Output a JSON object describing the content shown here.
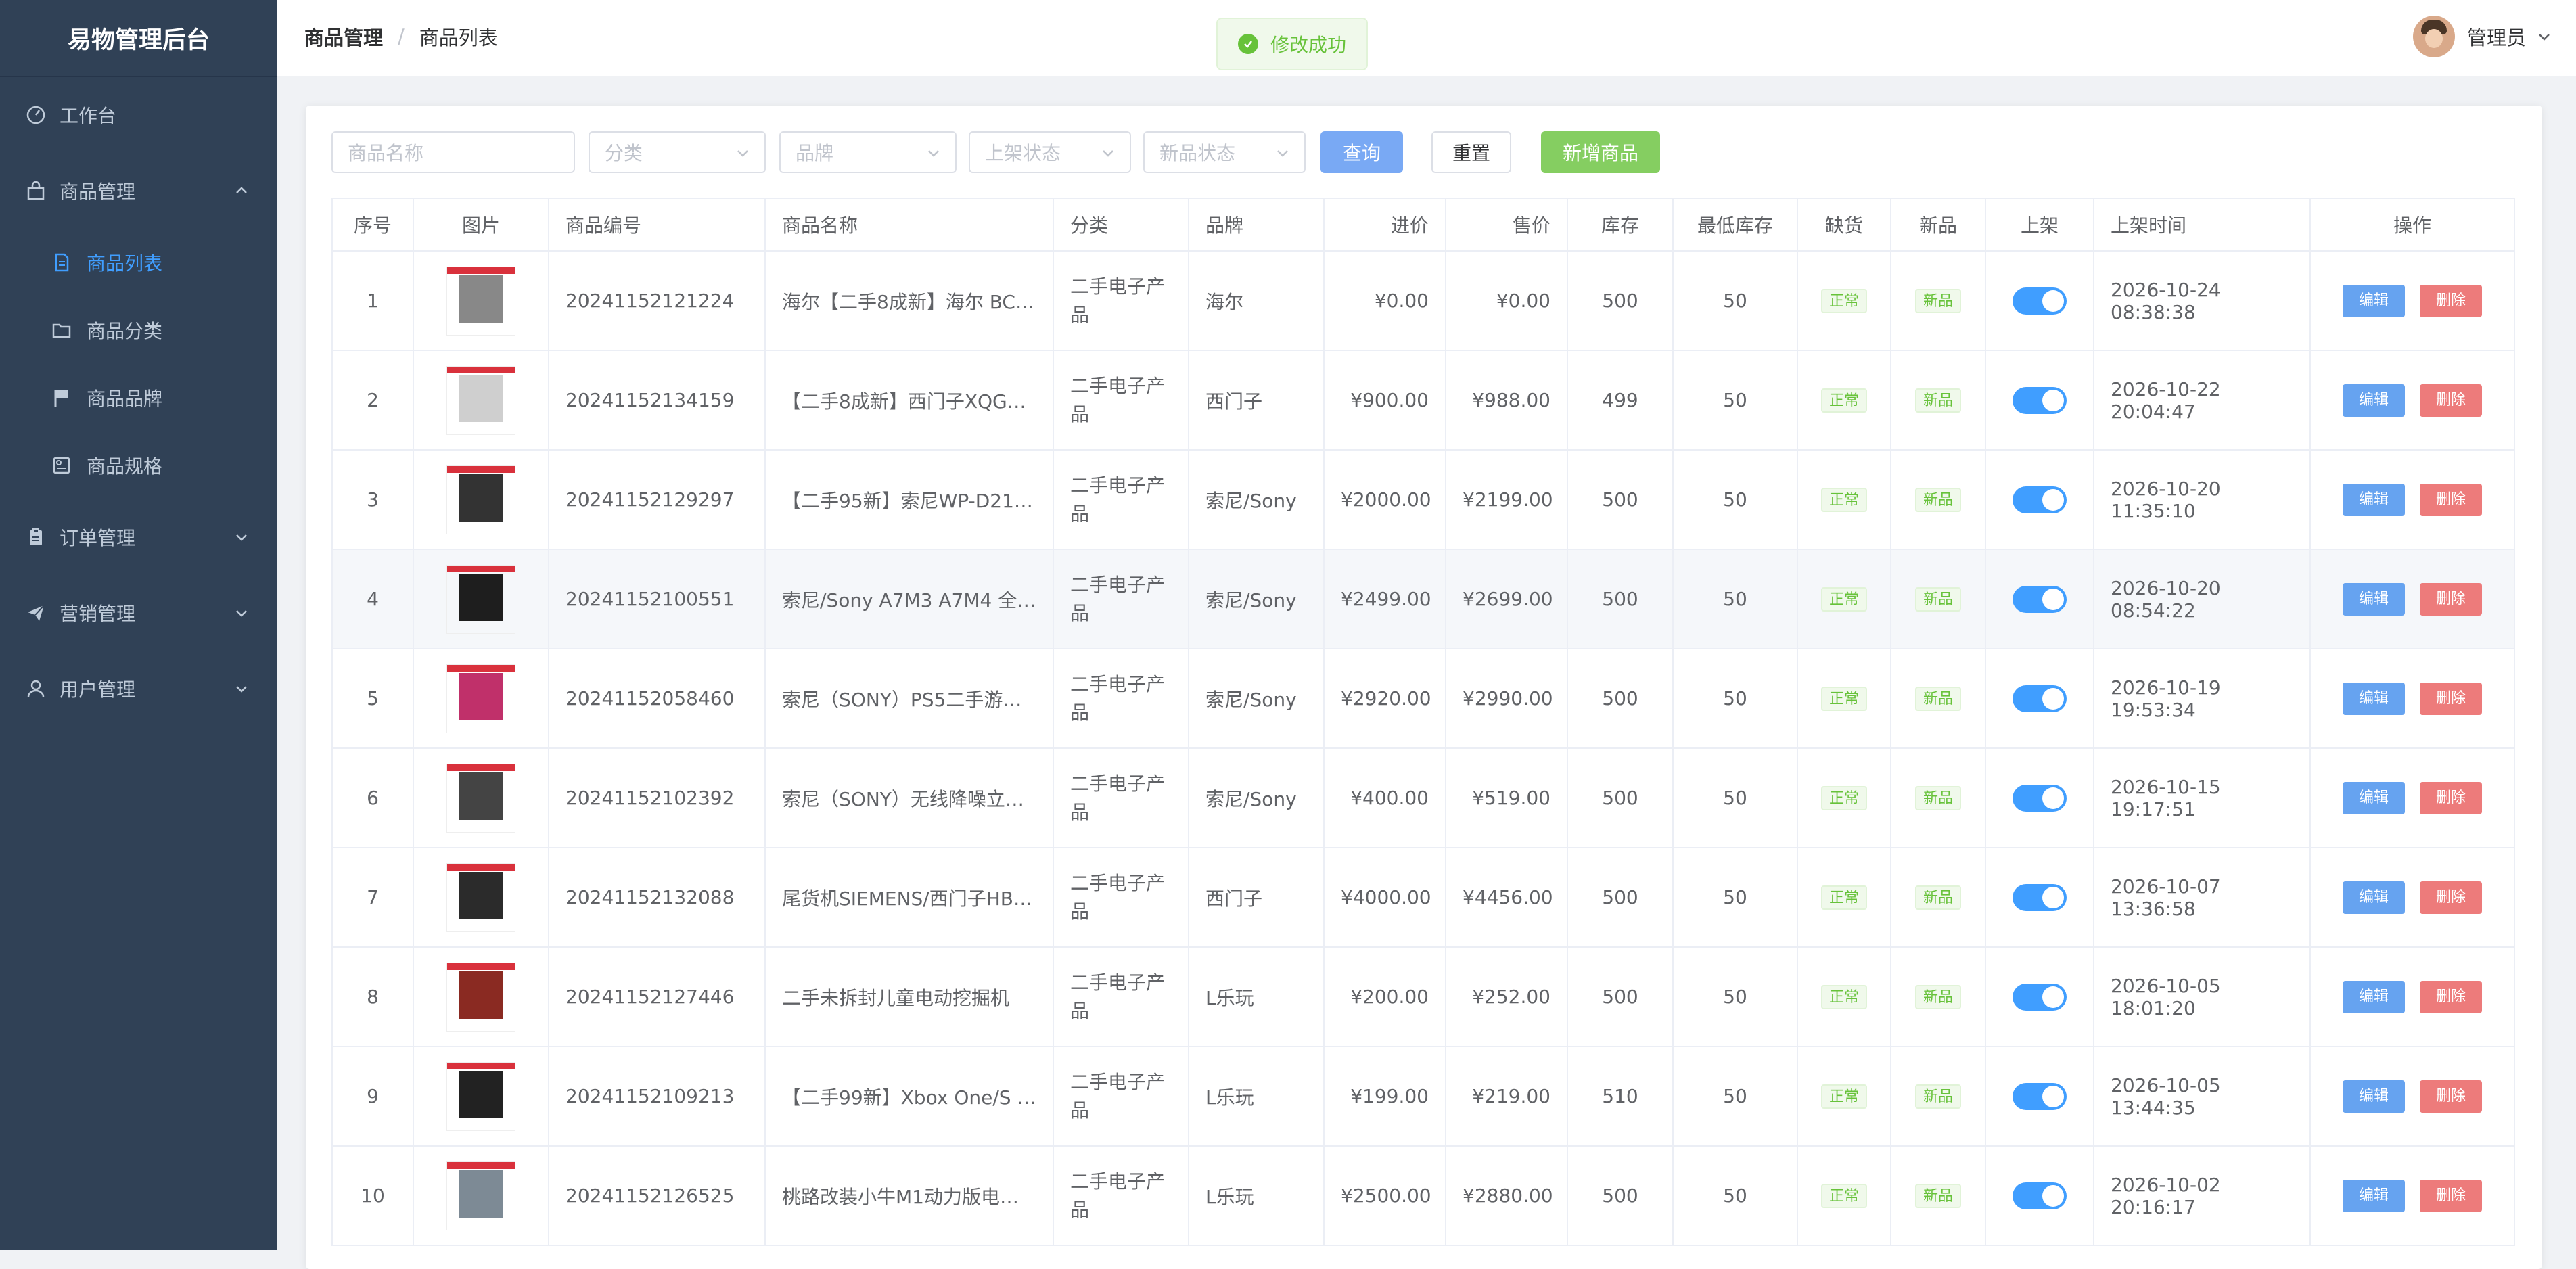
{
  "app": {
    "title": "易物管理后台"
  },
  "sidebar": {
    "items": [
      {
        "label": "工作台",
        "icon": "dashboard-icon"
      },
      {
        "label": "商品管理",
        "icon": "shopping-bag-icon",
        "expanded": true,
        "children": [
          {
            "label": "商品列表",
            "icon": "document-icon",
            "active": true
          },
          {
            "label": "商品分类",
            "icon": "folder-icon"
          },
          {
            "label": "商品品牌",
            "icon": "flag-icon"
          },
          {
            "label": "商品规格",
            "icon": "spec-icon"
          }
        ]
      },
      {
        "label": "订单管理",
        "icon": "order-icon"
      },
      {
        "label": "营销管理",
        "icon": "send-icon"
      },
      {
        "label": "用户管理",
        "icon": "user-icon"
      }
    ]
  },
  "header": {
    "breadcrumb": [
      "商品管理",
      "商品列表"
    ],
    "separator": "/",
    "user_name": "管理员"
  },
  "toast": {
    "message": "修改成功",
    "type": "success"
  },
  "filters": {
    "name_placeholder": "商品名称",
    "category_placeholder": "分类",
    "brand_placeholder": "品牌",
    "shelf_placeholder": "上架状态",
    "new_placeholder": "新品状态",
    "query_label": "查询",
    "reset_label": "重置",
    "add_label": "新增商品"
  },
  "table": {
    "headers": [
      "序号",
      "图片",
      "商品编号",
      "商品名称",
      "分类",
      "品牌",
      "进价",
      "售价",
      "库存",
      "最低库存",
      "缺货",
      "新品",
      "上架",
      "上架时间",
      "操作"
    ],
    "edit_label": "编辑",
    "delete_label": "删除",
    "rows": [
      {
        "no": "1",
        "code": "20241152121224",
        "name": "海尔【二手8成新】海尔 BC…",
        "category": "二手电子产品",
        "brand": "海尔",
        "cost": "¥0.00",
        "price": "¥0.00",
        "stock": "500",
        "min_stock": "50",
        "stock_status": "正常",
        "is_new": "新品",
        "on_shelf": true,
        "shelf_time": "2026-10-24 08:38:38",
        "thumb_color": "#888888"
      },
      {
        "no": "2",
        "code": "20241152134159",
        "name": "【二手8成新】西门子XQG5…",
        "category": "二手电子产品",
        "brand": "西门子",
        "cost": "¥900.00",
        "price": "¥988.00",
        "stock": "499",
        "min_stock": "50",
        "stock_status": "正常",
        "is_new": "新品",
        "on_shelf": true,
        "shelf_time": "2026-10-22 20:04:47",
        "thumb_color": "#cfcfcf"
      },
      {
        "no": "3",
        "code": "20241152129297",
        "name": "【二手95新】索尼WP-D21…",
        "category": "二手电子产品",
        "brand": "索尼/Sony",
        "cost": "¥2000.00",
        "price": "¥2199.00",
        "stock": "500",
        "min_stock": "50",
        "stock_status": "正常",
        "is_new": "新品",
        "on_shelf": true,
        "shelf_time": "2026-10-20 11:35:10",
        "thumb_color": "#333333"
      },
      {
        "no": "4",
        "code": "20241152100551",
        "name": "索尼/Sony A7M3 A7M4 全…",
        "category": "二手电子产品",
        "brand": "索尼/Sony",
        "cost": "¥2499.00",
        "price": "¥2699.00",
        "stock": "500",
        "min_stock": "50",
        "stock_status": "正常",
        "is_new": "新品",
        "on_shelf": true,
        "shelf_time": "2026-10-20 08:54:22",
        "thumb_color": "#1e1e1e",
        "highlighted": true
      },
      {
        "no": "5",
        "code": "20241152058460",
        "name": "索尼（SONY）PS5二手游…",
        "category": "二手电子产品",
        "brand": "索尼/Sony",
        "cost": "¥2920.00",
        "price": "¥2990.00",
        "stock": "500",
        "min_stock": "50",
        "stock_status": "正常",
        "is_new": "新品",
        "on_shelf": true,
        "shelf_time": "2026-10-19 19:53:34",
        "thumb_color": "#c0306a"
      },
      {
        "no": "6",
        "code": "20241152102392",
        "name": "索尼（SONY）无线降噪立…",
        "category": "二手电子产品",
        "brand": "索尼/Sony",
        "cost": "¥400.00",
        "price": "¥519.00",
        "stock": "500",
        "min_stock": "50",
        "stock_status": "正常",
        "is_new": "新品",
        "on_shelf": true,
        "shelf_time": "2026-10-15 19:17:51",
        "thumb_color": "#444444"
      },
      {
        "no": "7",
        "code": "20241152132088",
        "name": "尾货机SIEMENS/西门子HB…",
        "category": "二手电子产品",
        "brand": "西门子",
        "cost": "¥4000.00",
        "price": "¥4456.00",
        "stock": "500",
        "min_stock": "50",
        "stock_status": "正常",
        "is_new": "新品",
        "on_shelf": true,
        "shelf_time": "2026-10-07 13:36:58",
        "thumb_color": "#2b2b2b"
      },
      {
        "no": "8",
        "code": "20241152127446",
        "name": "二手未拆封儿童电动挖掘机",
        "category": "二手电子产品",
        "brand": "L乐玩",
        "cost": "¥200.00",
        "price": "¥252.00",
        "stock": "500",
        "min_stock": "50",
        "stock_status": "正常",
        "is_new": "新品",
        "on_shelf": true,
        "shelf_time": "2026-10-05 18:01:20",
        "thumb_color": "#8a2a22"
      },
      {
        "no": "9",
        "code": "20241152109213",
        "name": "【二手99新】Xbox One/S …",
        "category": "二手电子产品",
        "brand": "L乐玩",
        "cost": "¥199.00",
        "price": "¥219.00",
        "stock": "510",
        "min_stock": "50",
        "stock_status": "正常",
        "is_new": "新品",
        "on_shelf": true,
        "shelf_time": "2026-10-05 13:44:35",
        "thumb_color": "#222222"
      },
      {
        "no": "10",
        "code": "20241152126525",
        "name": "桃路改装小牛M1动力版电…",
        "category": "二手电子产品",
        "brand": "L乐玩",
        "cost": "¥2500.00",
        "price": "¥2880.00",
        "stock": "500",
        "min_stock": "50",
        "stock_status": "正常",
        "is_new": "新品",
        "on_shelf": true,
        "shelf_time": "2026-10-02 20:16:17",
        "thumb_color": "#7d8a95"
      }
    ]
  },
  "colors": {
    "sidebar_bg": "#304156",
    "accent": "#409eff",
    "success": "#67c23a",
    "danger": "#f56c6c"
  }
}
